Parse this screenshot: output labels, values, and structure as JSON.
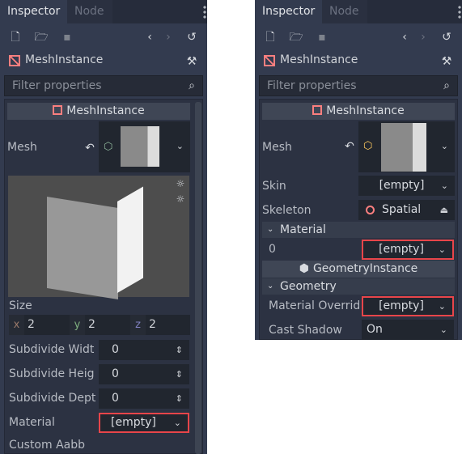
{
  "left": {
    "tabs": [
      {
        "label": "Inspector",
        "active": true
      },
      {
        "label": "Node",
        "active": false
      }
    ],
    "object": "MeshInstance",
    "filter_placeholder": "Filter properties",
    "section": "MeshInstance",
    "mesh_label": "Mesh",
    "size_label": "Size",
    "size": {
      "x_label": "x",
      "x": "2",
      "y_label": "y",
      "y": "2",
      "z_label": "z",
      "z": "2"
    },
    "rows": [
      {
        "label": "Subdivide Widt",
        "value": "0"
      },
      {
        "label": "Subdivide Heig",
        "value": "0"
      },
      {
        "label": "Subdivide Dept",
        "value": "0"
      }
    ],
    "material_label": "Material",
    "material_value": "[empty]",
    "custom_aabb": "Custom Aabb"
  },
  "right": {
    "tabs": [
      {
        "label": "Inspector",
        "active": true
      },
      {
        "label": "Node",
        "active": false
      }
    ],
    "object": "MeshInstance",
    "filter_placeholder": "Filter properties",
    "section": "MeshInstance",
    "mesh_label": "Mesh",
    "skin_label": "Skin",
    "skin_value": "[empty]",
    "skeleton_label": "Skeleton",
    "skeleton_value": "Spatial",
    "material_group": "Material",
    "material_0_label": "0",
    "material_0_value": "[empty]",
    "section2": "GeometryInstance",
    "geometry_group": "Geometry",
    "override_label": "Material Overrid",
    "override_value": "[empty]",
    "cast_shadow_label": "Cast Shadow",
    "cast_shadow_value": "On"
  },
  "colors": {
    "highlight": "#e8454a",
    "mesh_icon": "#fc7f7f",
    "mesh_resource_left": "#8eb59a",
    "mesh_resource_right": "#ffca5f"
  }
}
